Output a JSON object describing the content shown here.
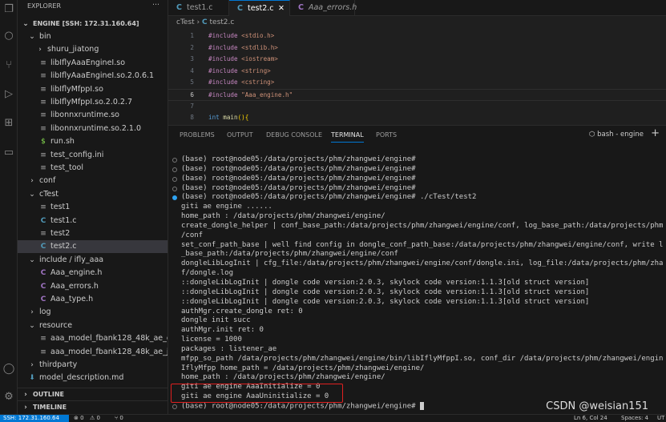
{
  "activity_bar": {
    "icons": [
      "files-icon",
      "search-icon",
      "source-control-icon",
      "run-debug-icon",
      "extensions-icon",
      "remote-explorer-icon",
      "account-icon",
      "gear-icon"
    ]
  },
  "sidebar": {
    "title": "EXPLORER",
    "more": "···",
    "root": "ENGINE [SSH: 172.31.160.64]",
    "items": [
      {
        "label": "bin",
        "kind": "folder-open",
        "depth": 1
      },
      {
        "label": "shuru_jiatong",
        "kind": "folder",
        "depth": 2
      },
      {
        "label": "libIflyAaaEngineI.so",
        "kind": "file",
        "depth": 2
      },
      {
        "label": "libIflyAaaEngineI.so.2.0.6.1",
        "kind": "file",
        "depth": 2
      },
      {
        "label": "libIflyMfppI.so",
        "kind": "file",
        "depth": 2
      },
      {
        "label": "libIflyMfppI.so.2.0.2.7",
        "kind": "file",
        "depth": 2
      },
      {
        "label": "libonnxruntime.so",
        "kind": "file",
        "depth": 2
      },
      {
        "label": "libonnxruntime.so.2.1.0",
        "kind": "file",
        "depth": 2
      },
      {
        "label": "run.sh",
        "kind": "shell",
        "depth": 2
      },
      {
        "label": "test_config.ini",
        "kind": "file",
        "depth": 2
      },
      {
        "label": "test_tool",
        "kind": "file",
        "depth": 2
      },
      {
        "label": "conf",
        "kind": "folder",
        "depth": 1
      },
      {
        "label": "cTest",
        "kind": "folder-open",
        "depth": 1
      },
      {
        "label": "test1",
        "kind": "file",
        "depth": 2
      },
      {
        "label": "test1.c",
        "kind": "c",
        "depth": 2
      },
      {
        "label": "test2",
        "kind": "file",
        "depth": 2
      },
      {
        "label": "test2.c",
        "kind": "c",
        "depth": 2,
        "selected": true
      },
      {
        "label": "include / ifly_aaa",
        "kind": "folder-open",
        "depth": 1
      },
      {
        "label": "Aaa_engine.h",
        "kind": "h",
        "depth": 2
      },
      {
        "label": "Aaa_errors.h",
        "kind": "h",
        "depth": 2
      },
      {
        "label": "Aaa_type.h",
        "kind": "h",
        "depth": 2
      },
      {
        "label": "log",
        "kind": "folder",
        "depth": 1
      },
      {
        "label": "resource",
        "kind": "folder-open",
        "depth": 1
      },
      {
        "label": "aaa_model_fbank128_48k_ae_dianji...",
        "kind": "file",
        "depth": 2
      },
      {
        "label": "aaa_model_fbank128_48k_ae_jians...",
        "kind": "file",
        "depth": 2
      },
      {
        "label": "thirdparty",
        "kind": "folder",
        "depth": 1
      },
      {
        "label": "model_description.md",
        "kind": "md",
        "depth": 1
      }
    ],
    "outline": "OUTLINE",
    "timeline": "TIMELINE"
  },
  "tabs": [
    {
      "label": "test1.c",
      "icon": "C",
      "active": false
    },
    {
      "label": "test2.c",
      "icon": "C",
      "active": true,
      "close": "✕"
    },
    {
      "label": "Aaa_errors.h",
      "icon": "C",
      "active": false,
      "italic": true
    }
  ],
  "breadcrumb": {
    "folder": "cTest",
    "sep": "›",
    "icon": "C",
    "file": "test2.c"
  },
  "code": [
    {
      "n": "1",
      "kw": "#include",
      "rest": " <stdio.h>"
    },
    {
      "n": "2",
      "kw": "#include",
      "rest": " <stdlib.h>"
    },
    {
      "n": "3",
      "kw": "#include",
      "rest": " <iostream>"
    },
    {
      "n": "4",
      "kw": "#include",
      "rest": " <string>"
    },
    {
      "n": "5",
      "kw": "#include",
      "rest": " <cstring>"
    },
    {
      "n": "6",
      "kw": "#include",
      "rest": " \"Aaa_engine.h\""
    },
    {
      "n": "7",
      "kw": "",
      "rest": ""
    },
    {
      "n": "8",
      "type": "int",
      "fn": " main",
      "br": "(){"
    }
  ],
  "panel": {
    "tabs": [
      "PROBLEMS",
      "OUTPUT",
      "DEBUG CONSOLE",
      "TERMINAL",
      "PORTS"
    ],
    "active_tab": "TERMINAL",
    "shell": "bash - engine",
    "add": "+",
    "chevron": "⌄"
  },
  "terminal": [
    {
      "t": "(base) root@node05:/data/projects/phm/zhangwei/engine#",
      "dot": "grey"
    },
    {
      "t": "(base) root@node05:/data/projects/phm/zhangwei/engine#",
      "dot": "grey"
    },
    {
      "t": "(base) root@node05:/data/projects/phm/zhangwei/engine#",
      "dot": "grey"
    },
    {
      "t": "(base) root@node05:/data/projects/phm/zhangwei/engine#",
      "dot": "grey"
    },
    {
      "t": "(base) root@node05:/data/projects/phm/zhangwei/engine# ./cTest/test2",
      "dot": "blue"
    },
    {
      "t": "giti ae engine ......"
    },
    {
      "t": "home_path : /data/projects/phm/zhangwei/engine/"
    },
    {
      "t": "create_dongle_helper | conf_base_path:/data/projects/phm/zhangwei/engine/conf, log_base_path:/data/projects/phm"
    },
    {
      "t": "/conf"
    },
    {
      "t": "set_conf_path_base | well find config in dongle_conf_path_base:/data/projects/phm/zhangwei/engine/conf, write l"
    },
    {
      "t": "_base_path:/data/projects/phm/zhangwei/engine/conf"
    },
    {
      "t": "dongleLibLogInit | cfg_file:/data/projects/phm/zhangwei/engine/conf/dongle.ini, log_file:/data/projects/phm/zha"
    },
    {
      "t": "f/dongle.log"
    },
    {
      "t": "::dongleLibLogInit | dongle code version:2.0.3, skylock code version:1.1.3[old struct version]"
    },
    {
      "t": "::dongleLibLogInit | dongle code version:2.0.3, skylock code version:1.1.3[old struct version]"
    },
    {
      "t": "::dongleLibLogInit | dongle code version:2.0.3, skylock code version:1.1.3[old struct version]"
    },
    {
      "t": "authMgr.create_dongle ret: 0"
    },
    {
      "t": "dongle init succ"
    },
    {
      "t": "authMgr.init ret: 0"
    },
    {
      "t": "license = 1000"
    },
    {
      "t": "packages : listener_ae"
    },
    {
      "t": "mfpp_so_path /data/projects/phm/zhangwei/engine/bin/libIflyMfppI.so, conf_dir /data/projects/phm/zhangwei/engin"
    },
    {
      "t": "IflyMfpp home_path = /data/projects/phm/zhangwei/engine/"
    },
    {
      "t": "home_path : /data/projects/phm/zhangwei/engine/"
    },
    {
      "t": "giti ae engine AaaInitialize = 0"
    },
    {
      "t": "giti ae engine AaaUninitialize = 0"
    },
    {
      "t": "(base) root@node05:/data/projects/phm/zhangwei/engine#",
      "dot": "grey",
      "cursor": true
    }
  ],
  "watermark": "CSDN @weisian151",
  "status": {
    "remote": "SSH: 172.31.160.64",
    "errors": "⊗ 0",
    "warnings": "⚠ 0",
    "ports": "⑂ 0",
    "position": "Ln 6, Col 24",
    "spaces": "Spaces: 4",
    "encoding": "UT"
  },
  "colors": {
    "accent": "#0078d4",
    "highlight_box": "#e02020",
    "c_icon": "#519aba",
    "h_icon": "#a074c4",
    "shell_icon": "#89e051"
  }
}
